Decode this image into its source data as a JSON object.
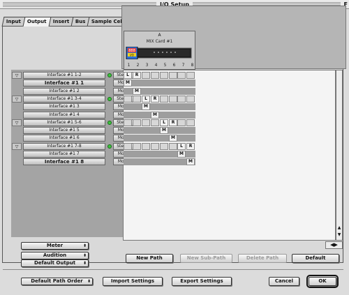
{
  "window": {
    "title": "I/O Setup",
    "zoom_glyph": "F"
  },
  "tabs": [
    {
      "label": "Input",
      "active": false
    },
    {
      "label": "Output",
      "active": true
    },
    {
      "label": "Insert",
      "active": false
    },
    {
      "label": "Bus",
      "active": false
    },
    {
      "label": "Sample Cell",
      "active": false
    }
  ],
  "device": {
    "number": "A",
    "name": "MIX Card #1",
    "badge": "888",
    "badge_sub": "I/O",
    "channels": [
      "1",
      "2",
      "3",
      "4",
      "5",
      "6",
      "7",
      "8"
    ]
  },
  "paths": [
    {
      "name": "Interface #1 1-2",
      "kind": "main",
      "format": "Stereo",
      "active": true,
      "assign": [
        "L",
        "R",
        "",
        "",
        "",
        "",
        "",
        ""
      ]
    },
    {
      "name": "Interface #1 1",
      "kind": "sub",
      "format": "Mono",
      "assign": [
        "M",
        "",
        "",
        "",
        "",
        "",
        "",
        ""
      ]
    },
    {
      "name": "Interface #1 2",
      "kind": "sub-small",
      "format": "Mono",
      "assign": [
        "",
        "M",
        "",
        "",
        "",
        "",
        "",
        ""
      ]
    },
    {
      "name": "Interface #1 3-4",
      "kind": "main",
      "format": "Stereo",
      "active": true,
      "assign": [
        "",
        "",
        "L",
        "R",
        "",
        "",
        "",
        ""
      ]
    },
    {
      "name": "Interface #1 3",
      "kind": "sub-small",
      "format": "Mono",
      "assign": [
        "",
        "",
        "M",
        "",
        "",
        "",
        "",
        ""
      ]
    },
    {
      "name": "Interface #1 4",
      "kind": "sub-small",
      "format": "Mono",
      "assign": [
        "",
        "",
        "",
        "M",
        "",
        "",
        "",
        ""
      ]
    },
    {
      "name": "Interface #1 5-6",
      "kind": "main",
      "format": "Stereo",
      "active": true,
      "assign": [
        "",
        "",
        "",
        "",
        "L",
        "R",
        "",
        ""
      ]
    },
    {
      "name": "Interface #1 5",
      "kind": "sub-small",
      "format": "Mono",
      "assign": [
        "",
        "",
        "",
        "",
        "M",
        "",
        "",
        ""
      ]
    },
    {
      "name": "Interface #1 6",
      "kind": "sub-small",
      "format": "Mono",
      "assign": [
        "",
        "",
        "",
        "",
        "",
        "M",
        "",
        ""
      ]
    },
    {
      "name": "Interface #1 7-8",
      "kind": "main",
      "format": "Stereo",
      "active": true,
      "assign": [
        "",
        "",
        "",
        "",
        "",
        "",
        "L",
        "R"
      ]
    },
    {
      "name": "Interface #1 7",
      "kind": "sub-small",
      "format": "Mono",
      "assign": [
        "",
        "",
        "",
        "",
        "",
        "",
        "M",
        ""
      ]
    },
    {
      "name": "Interface #1 8",
      "kind": "sub",
      "format": "Mono",
      "assign": [
        "",
        "",
        "",
        "",
        "",
        "",
        "",
        "M"
      ]
    }
  ],
  "popups": {
    "meter": "Meter",
    "audition": "Audition",
    "default_output": "Default Output",
    "default_path_order": "Default Path Order"
  },
  "buttons": {
    "new_path": "New Path",
    "new_sub_path": "New Sub-Path",
    "delete_path": "Delete Path",
    "default": "Default",
    "import_settings": "Import Settings",
    "export_settings": "Export Settings",
    "cancel": "Cancel",
    "ok": "OK"
  },
  "icons": {
    "disclosure": "▽",
    "popup_caret": "⬍",
    "scroll_up": "▲",
    "scroll_down": "▼",
    "hscroll": "◀▶"
  }
}
